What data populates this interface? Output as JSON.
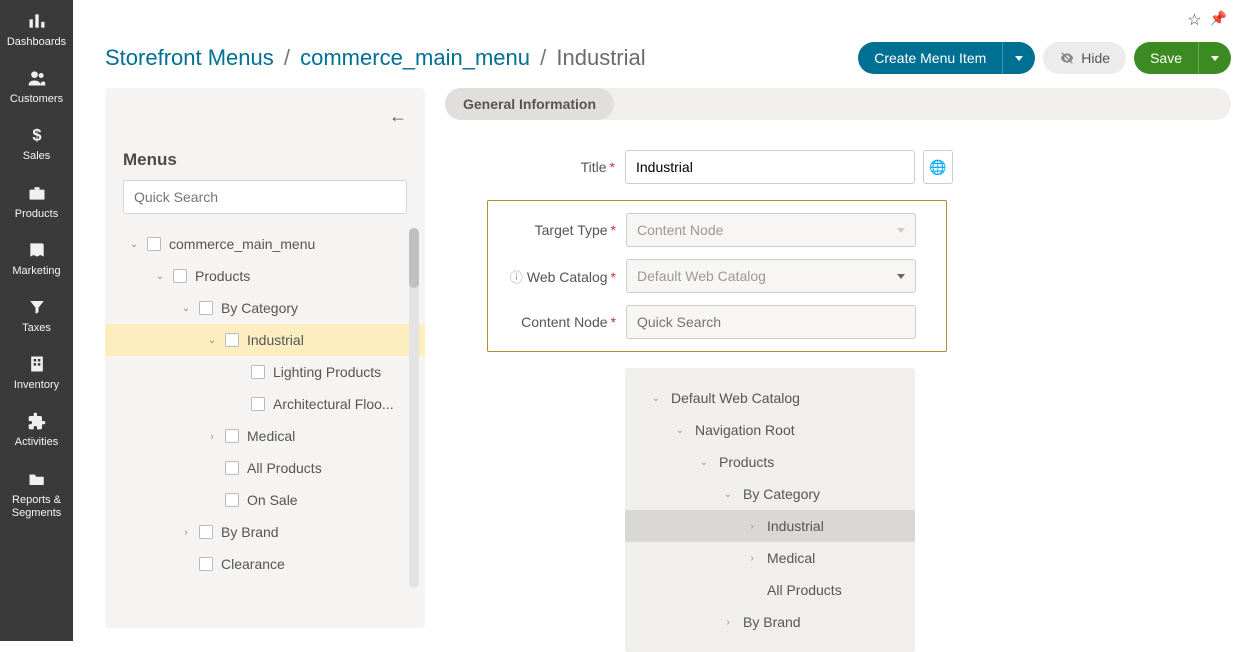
{
  "nav": [
    {
      "label": "Dashboards"
    },
    {
      "label": "Customers"
    },
    {
      "label": "Sales"
    },
    {
      "label": "Products"
    },
    {
      "label": "Marketing"
    },
    {
      "label": "Taxes"
    },
    {
      "label": "Inventory"
    },
    {
      "label": "Activities"
    },
    {
      "label": "Reports & Segments"
    }
  ],
  "breadcrumb": {
    "a": "Storefront Menus",
    "b": "commerce_main_menu",
    "c": "Industrial"
  },
  "actions": {
    "create": "Create Menu Item",
    "hide": "Hide",
    "save": "Save"
  },
  "panel": {
    "title": "Menus",
    "search_placeholder": "Quick Search"
  },
  "menu_tree": [
    {
      "label": "commerce_main_menu",
      "depth": 0,
      "toggle": "v"
    },
    {
      "label": "Products",
      "depth": 1,
      "toggle": "v"
    },
    {
      "label": "By Category",
      "depth": 2,
      "toggle": "v"
    },
    {
      "label": "Industrial",
      "depth": 3,
      "toggle": "v",
      "selected": true
    },
    {
      "label": "Lighting Products",
      "depth": 4,
      "toggle": ""
    },
    {
      "label": "Architectural Floo...",
      "depth": 4,
      "toggle": ""
    },
    {
      "label": "Medical",
      "depth": 3,
      "toggle": ">"
    },
    {
      "label": "All Products",
      "depth": 3,
      "toggle": ""
    },
    {
      "label": "On Sale",
      "depth": 3,
      "toggle": ""
    },
    {
      "label": "By Brand",
      "depth": 2,
      "toggle": ">"
    },
    {
      "label": "Clearance",
      "depth": 2,
      "toggle": ""
    }
  ],
  "tab": "General Information",
  "form": {
    "title_label": "Title",
    "title_value": "Industrial",
    "target_type_label": "Target Type",
    "target_type_value": "Content Node",
    "web_catalog_label": "Web Catalog",
    "web_catalog_value": "Default Web Catalog",
    "content_node_label": "Content Node",
    "content_node_placeholder": "Quick Search"
  },
  "catalog_tree": [
    {
      "label": "Default Web Catalog",
      "depth": 0,
      "toggle": "v"
    },
    {
      "label": "Navigation Root",
      "depth": 1,
      "toggle": "v"
    },
    {
      "label": "Products",
      "depth": 2,
      "toggle": "v"
    },
    {
      "label": "By Category",
      "depth": 3,
      "toggle": "v"
    },
    {
      "label": "Industrial",
      "depth": 4,
      "toggle": ">",
      "selected": true
    },
    {
      "label": "Medical",
      "depth": 4,
      "toggle": ">"
    },
    {
      "label": "All Products",
      "depth": 4,
      "toggle": ""
    },
    {
      "label": "By Brand",
      "depth": 3,
      "toggle": ">"
    }
  ]
}
